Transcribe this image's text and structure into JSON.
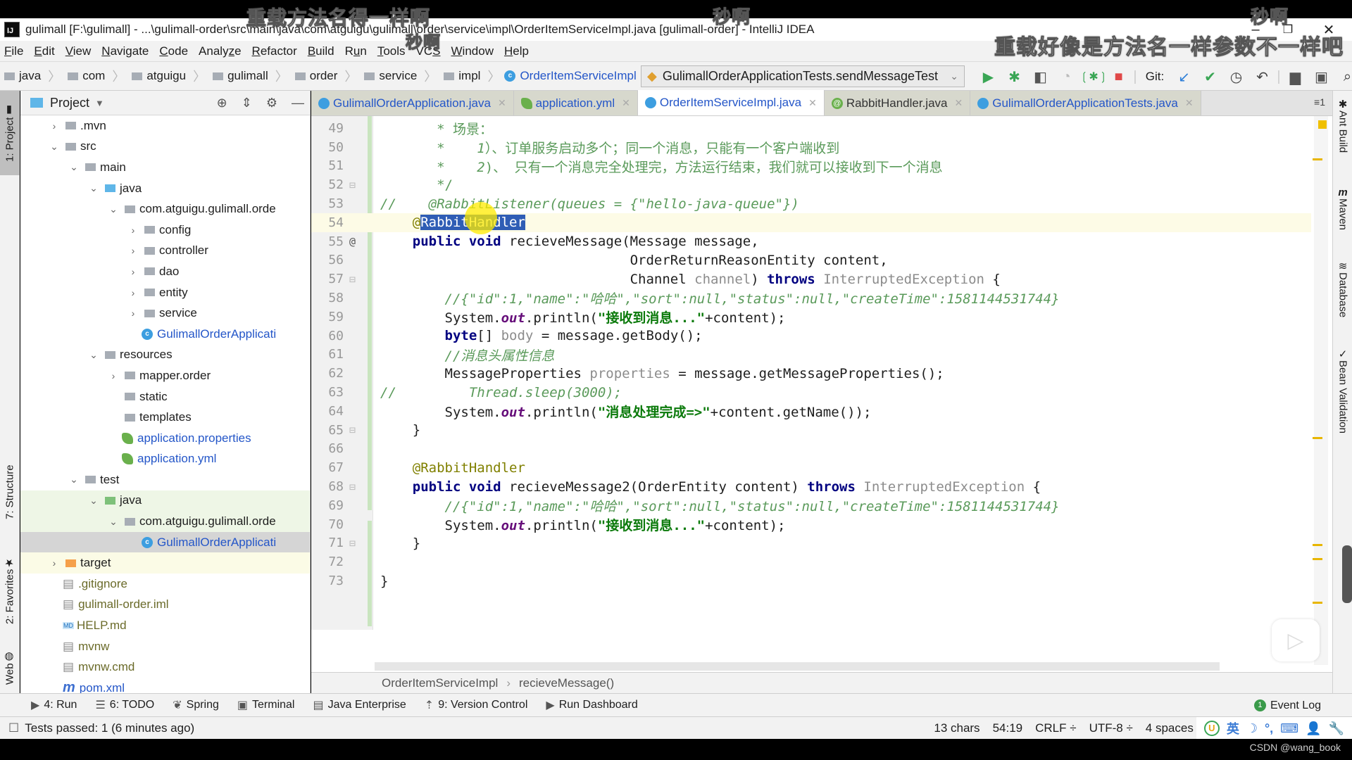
{
  "window": {
    "title": "gulimall [F:\\gulimall] - ...\\gulimall-order\\src\\main\\java\\com\\atguigu\\gulimall\\order\\service\\impl\\OrderItemServiceImpl.java [gulimall-order] - IntelliJ IDEA",
    "logo": "IJ",
    "minimize": "–",
    "restore": "❐",
    "close": "✕"
  },
  "menu": [
    {
      "pre": "",
      "u": "F",
      "post": "ile"
    },
    {
      "pre": "",
      "u": "E",
      "post": "dit"
    },
    {
      "pre": "",
      "u": "V",
      "post": "iew"
    },
    {
      "pre": "",
      "u": "N",
      "post": "avigate"
    },
    {
      "pre": "",
      "u": "C",
      "post": "ode"
    },
    {
      "pre": "Analy",
      "u": "z",
      "post": "e"
    },
    {
      "pre": "",
      "u": "R",
      "post": "efactor"
    },
    {
      "pre": "",
      "u": "B",
      "post": "uild"
    },
    {
      "pre": "R",
      "u": "u",
      "post": "n"
    },
    {
      "pre": "",
      "u": "T",
      "post": "ools"
    },
    {
      "pre": "VC",
      "u": "S",
      "post": ""
    },
    {
      "pre": "",
      "u": "W",
      "post": "indow"
    },
    {
      "pre": "",
      "u": "H",
      "post": "elp"
    }
  ],
  "nav_breadcrumb": [
    "java",
    "com",
    "atguigu",
    "gulimall",
    "order",
    "service",
    "impl"
  ],
  "nav_class": "OrderItemServiceImpl",
  "run_config": "GulimallOrderApplicationTests.sendMessageTest",
  "git_label": "Git:",
  "project_panel": {
    "title": "Project",
    "tree": [
      {
        "indent": 1,
        "arrow": "›",
        "icon": "folder",
        "label": ".mvn",
        "cls": ""
      },
      {
        "indent": 1,
        "arrow": "⌄",
        "icon": "folder",
        "label": "src",
        "cls": ""
      },
      {
        "indent": 2,
        "arrow": "⌄",
        "icon": "folder",
        "label": "main",
        "cls": ""
      },
      {
        "indent": 3,
        "arrow": "⌄",
        "icon": "folder-blue",
        "label": "java",
        "cls": ""
      },
      {
        "indent": 4,
        "arrow": "⌄",
        "icon": "package",
        "label": "com.atguigu.gulimall.orde",
        "cls": ""
      },
      {
        "indent": 5,
        "arrow": "›",
        "icon": "package",
        "label": "config",
        "cls": ""
      },
      {
        "indent": 5,
        "arrow": "›",
        "icon": "package",
        "label": "controller",
        "cls": ""
      },
      {
        "indent": 5,
        "arrow": "›",
        "icon": "package",
        "label": "dao",
        "cls": ""
      },
      {
        "indent": 5,
        "arrow": "›",
        "icon": "package",
        "label": "entity",
        "cls": ""
      },
      {
        "indent": 5,
        "arrow": "›",
        "icon": "package",
        "label": "service",
        "cls": ""
      },
      {
        "indent": 5,
        "arrow": "",
        "icon": "class",
        "label": "GulimallOrderApplicati",
        "cls": "blue"
      },
      {
        "indent": 3,
        "arrow": "⌄",
        "icon": "folder",
        "label": "resources",
        "cls": ""
      },
      {
        "indent": 4,
        "arrow": "›",
        "icon": "package",
        "label": "mapper.order",
        "cls": ""
      },
      {
        "indent": 4,
        "arrow": "",
        "icon": "package",
        "label": "static",
        "cls": ""
      },
      {
        "indent": 4,
        "arrow": "",
        "icon": "package",
        "label": "templates",
        "cls": ""
      },
      {
        "indent": 4,
        "arrow": "",
        "icon": "spring",
        "label": "application.properties",
        "cls": "blue"
      },
      {
        "indent": 4,
        "arrow": "",
        "icon": "spring",
        "label": "application.yml",
        "cls": "blue"
      },
      {
        "indent": 2,
        "arrow": "⌄",
        "icon": "folder",
        "label": "test",
        "cls": ""
      },
      {
        "indent": 3,
        "arrow": "⌄",
        "icon": "folder-green",
        "label": "java",
        "cls": "hl-green"
      },
      {
        "indent": 4,
        "arrow": "⌄",
        "icon": "package",
        "label": "com.atguigu.gulimall.orde",
        "cls": "hl-green"
      },
      {
        "indent": 5,
        "arrow": "",
        "icon": "class",
        "label": "GulimallOrderApplicati",
        "cls": "blue hl-gray"
      },
      {
        "indent": 1,
        "arrow": "›",
        "icon": "folder-orange",
        "label": "target",
        "cls": "hl-yellow"
      },
      {
        "indent": 1,
        "arrow": "",
        "icon": "file",
        "label": ".gitignore",
        "cls": "olive"
      },
      {
        "indent": 1,
        "arrow": "",
        "icon": "file",
        "label": "gulimall-order.iml",
        "cls": "olive"
      },
      {
        "indent": 1,
        "arrow": "",
        "icon": "md",
        "label": "HELP.md",
        "cls": "olive"
      },
      {
        "indent": 1,
        "arrow": "",
        "icon": "file",
        "label": "mvnw",
        "cls": "olive"
      },
      {
        "indent": 1,
        "arrow": "",
        "icon": "file",
        "label": "mvnw.cmd",
        "cls": "olive"
      },
      {
        "indent": 1,
        "arrow": "",
        "icon": "maven",
        "label": "pom.xml",
        "cls": "blue"
      }
    ]
  },
  "left_tool_tabs": [
    "1: Project",
    "7: Structure",
    "2: Favorites",
    "Web"
  ],
  "right_tool_tabs": [
    "Ant Build",
    "Maven",
    "Database",
    "Bean Validation"
  ],
  "editor_tabs": [
    {
      "label": "GulimallOrderApplication.java",
      "icon": "class",
      "active": false
    },
    {
      "label": "application.yml",
      "icon": "spring",
      "active": false
    },
    {
      "label": "OrderItemServiceImpl.java",
      "icon": "class",
      "active": true
    },
    {
      "label": "RabbitHandler.java",
      "icon": "at",
      "active": false
    },
    {
      "label": "GulimallOrderApplicationTests.java",
      "icon": "class",
      "active": false
    }
  ],
  "tab_overflow": "≡1",
  "code_lines": [
    {
      "n": "49",
      "mark": "",
      "html": "       <span class='cmn'>* 场景：</span>"
    },
    {
      "n": "50",
      "mark": "",
      "html": "       <span class='cmn'>*    <i>1</i>）、订单服务启动多个；同一个消息，只能有一个客户端收到</span>"
    },
    {
      "n": "51",
      "mark": "",
      "html": "       <span class='cmn'>*    <i>2</i>)、 只有一个消息完全处理完，方法运行结束，我们就可以接收到下一个消息</span>"
    },
    {
      "n": "52",
      "mark": "fold",
      "html": "       <span class='cmn'>*/</span>"
    },
    {
      "n": "53",
      "mark": "",
      "html": "<span class='cm'>//    @RabbitListener(queues = {\"hello-java-queue\"})</span>"
    },
    {
      "n": "54",
      "mark": "",
      "html": "    <span class='ann'>@</span><span class='sel'>RabbitHandler</span>",
      "current": true
    },
    {
      "n": "55",
      "mark": "@",
      "html": "    <span class='kw'>public void</span> recieveMessage(Message message,"
    },
    {
      "n": "56",
      "mark": "",
      "html": "                               OrderReturnReasonEntity content,"
    },
    {
      "n": "57",
      "mark": "fold",
      "html": "                               Channel <span class='gry'>channel</span>) <span class='kw'>throws</span> <span class='gry'>InterruptedException</span> {"
    },
    {
      "n": "58",
      "mark": "",
      "html": "        <span class='cm'>//{\"id\":1,\"name\":\"哈哈\",\"sort\":null,\"status\":null,\"createTime\":1581144531744}</span>"
    },
    {
      "n": "59",
      "mark": "",
      "html": "        System.<span class='fld'>out</span>.println(<span class='str'>\"接收到消息...\"</span>+content);"
    },
    {
      "n": "60",
      "mark": "",
      "html": "        <span class='kw'>byte</span>[] <span class='gry'>body</span> = message.getBody();"
    },
    {
      "n": "61",
      "mark": "",
      "html": "        <span class='cm'>//消息头属性信息</span>"
    },
    {
      "n": "62",
      "mark": "",
      "html": "        MessageProperties <span class='gry'>properties</span> = message.getMessageProperties();"
    },
    {
      "n": "63",
      "mark": "",
      "html": "<span class='cm'>//         Thread.sleep(3000);</span>"
    },
    {
      "n": "64",
      "mark": "",
      "html": "        System.<span class='fld'>out</span>.println(<span class='str'>\"消息处理完成=>\"</span>+content.getName());"
    },
    {
      "n": "65",
      "mark": "fold",
      "html": "    }"
    },
    {
      "n": "66",
      "mark": "",
      "html": ""
    },
    {
      "n": "67",
      "mark": "",
      "html": "    <span class='ann'>@RabbitHandler</span>"
    },
    {
      "n": "68",
      "mark": "fold",
      "html": "    <span class='kw'>public void</span> recieveMessage2(OrderEntity content) <span class='kw'>throws</span> <span class='gry'>InterruptedException</span> {"
    },
    {
      "n": "69",
      "mark": "",
      "html": "        <span class='cm'>//{\"id\":1,\"name\":\"哈哈\",\"sort\":null,\"status\":null,\"createTime\":1581144531744}</span>"
    },
    {
      "n": "70",
      "mark": "",
      "html": "        System.<span class='fld'>out</span>.println(<span class='str'>\"接收到消息...\"</span>+content);"
    },
    {
      "n": "71",
      "mark": "fold",
      "html": "    }"
    },
    {
      "n": "72",
      "mark": "",
      "html": ""
    },
    {
      "n": "73",
      "mark": "",
      "html": "}"
    }
  ],
  "editor_breadcrumb": {
    "class": "OrderItemServiceImpl",
    "method": "recieveMessage()"
  },
  "tool_windows": [
    {
      "glyph": "▶",
      "label": "4: Run"
    },
    {
      "glyph": "☰",
      "label": "6: TODO"
    },
    {
      "glyph": "❦",
      "label": "Spring"
    },
    {
      "glyph": "▣",
      "label": "Terminal"
    },
    {
      "glyph": "▤",
      "label": "Java Enterprise"
    },
    {
      "glyph": "⇡",
      "label": "9: Version Control"
    },
    {
      "glyph": "▶",
      "label": "Run Dashboard"
    }
  ],
  "event_log": {
    "badge": "1",
    "label": "Event Log"
  },
  "status": {
    "message": "Tests passed: 1 (6 minutes ago)",
    "selection": "13 chars",
    "position": "54:19",
    "line_sep": "CRLF ÷",
    "encoding": "UTF-8 ÷",
    "indent": "4 spaces",
    "ime": [
      "U",
      "英",
      "☽",
      "°,",
      "⌨",
      "👤",
      "🔧"
    ]
  },
  "overlays": {
    "subtitle_top_left": "重载方法名得一样啊",
    "subtitle_top_mid": "秒啊",
    "subtitle_top_mid2": "秒啊",
    "subtitle_top_right": "秒啊",
    "subtitle_right": "重载好像是方法名一样参数不一样吧",
    "watermark": "CSDN @wang_book"
  },
  "colors": {
    "keyword": "#000080",
    "comment": "#5a9a5a",
    "string": "#0b7a0b",
    "annotation": "#808000",
    "selection": "#2f5db5",
    "current_line": "#fdfbe6"
  }
}
